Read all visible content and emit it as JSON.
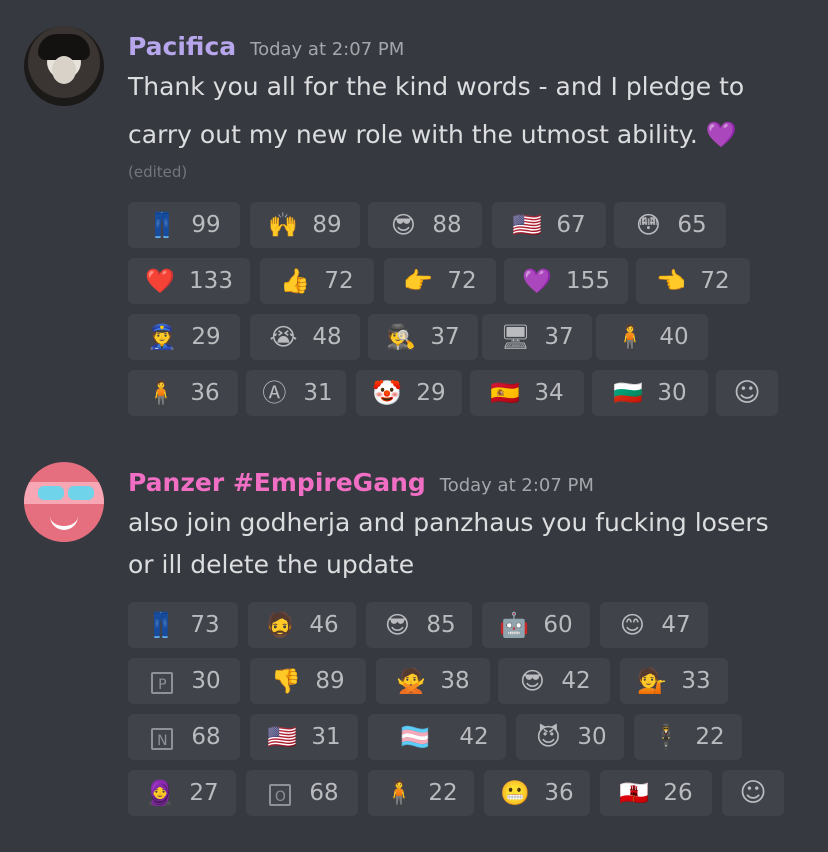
{
  "messages": [
    {
      "username": "Pacifica",
      "username_color": "#b7a6ec",
      "timestamp": "Today at 2:07 PM",
      "line1": "Thank you all for the kind words - and I pledge to",
      "line2": "carry out my new role with the utmost ability. 💜",
      "edited": "(edited)",
      "reaction_rows": [
        [
          {
            "emoji": "👖",
            "count": "99"
          },
          {
            "emoji": "🙌",
            "count": "89"
          },
          {
            "emoji": "😎",
            "count": "88"
          },
          {
            "emoji": "🇺🇸",
            "count": "67"
          },
          {
            "emoji": "😳",
            "count": "65"
          }
        ],
        [
          {
            "emoji": "❤️",
            "count": "133"
          },
          {
            "emoji": "👍",
            "count": "72"
          },
          {
            "emoji": "👉",
            "count": "72"
          },
          {
            "emoji": "💜",
            "count": "155"
          },
          {
            "emoji": "👈",
            "count": "72"
          }
        ],
        [
          {
            "emoji": "👮",
            "count": "29"
          },
          {
            "emoji": "😭",
            "count": "48"
          },
          {
            "emoji": "🕵",
            "count": "37"
          },
          {
            "emoji": "🖥",
            "count": "37"
          },
          {
            "emoji": "🧍",
            "count": "40"
          }
        ],
        [
          {
            "emoji": "🧍",
            "count": "36"
          },
          {
            "emoji": "Ⓐ",
            "count": "31"
          },
          {
            "emoji": "🤡",
            "count": "29"
          },
          {
            "emoji": "🇪🇸",
            "count": "34"
          },
          {
            "emoji": "🇧🇬",
            "count": "30"
          }
        ]
      ],
      "add_reaction_icon": "emoji-add-icon"
    },
    {
      "username": "Panzer #EmpireGang",
      "username_color": "#f06ec3",
      "timestamp": "Today at 2:07 PM",
      "line1": "also join godherja and panzhaus you fucking losers",
      "line2": "or ill delete the update",
      "reaction_rows": [
        [
          {
            "emoji": "👖",
            "count": "73"
          },
          {
            "emoji": "🧔",
            "count": "46"
          },
          {
            "emoji": "😎",
            "count": "85"
          },
          {
            "emoji": "🤖",
            "count": "60"
          },
          {
            "emoji": "😊",
            "count": "47"
          }
        ],
        [
          {
            "emoji": "P",
            "count": "30"
          },
          {
            "emoji": "👎",
            "count": "89"
          },
          {
            "emoji": "🙅",
            "count": "38"
          },
          {
            "emoji": "😎",
            "count": "42"
          },
          {
            "emoji": "💁",
            "count": "33"
          }
        ],
        [
          {
            "emoji": "N",
            "count": "68"
          },
          {
            "emoji": "🇺🇸",
            "count": "31"
          },
          {
            "emoji": "🏳️‍⚧",
            "count": "42"
          },
          {
            "emoji": "😈",
            "count": "30"
          },
          {
            "emoji": "🕴",
            "count": "22"
          }
        ],
        [
          {
            "emoji": "🧕",
            "count": "27"
          },
          {
            "emoji": "O",
            "count": "68"
          },
          {
            "emoji": "🧍",
            "count": "22"
          },
          {
            "emoji": "😬",
            "count": "36"
          },
          {
            "emoji": "🇬🇮",
            "count": "26"
          }
        ]
      ],
      "add_reaction_icon": "emoji-add-icon"
    }
  ]
}
